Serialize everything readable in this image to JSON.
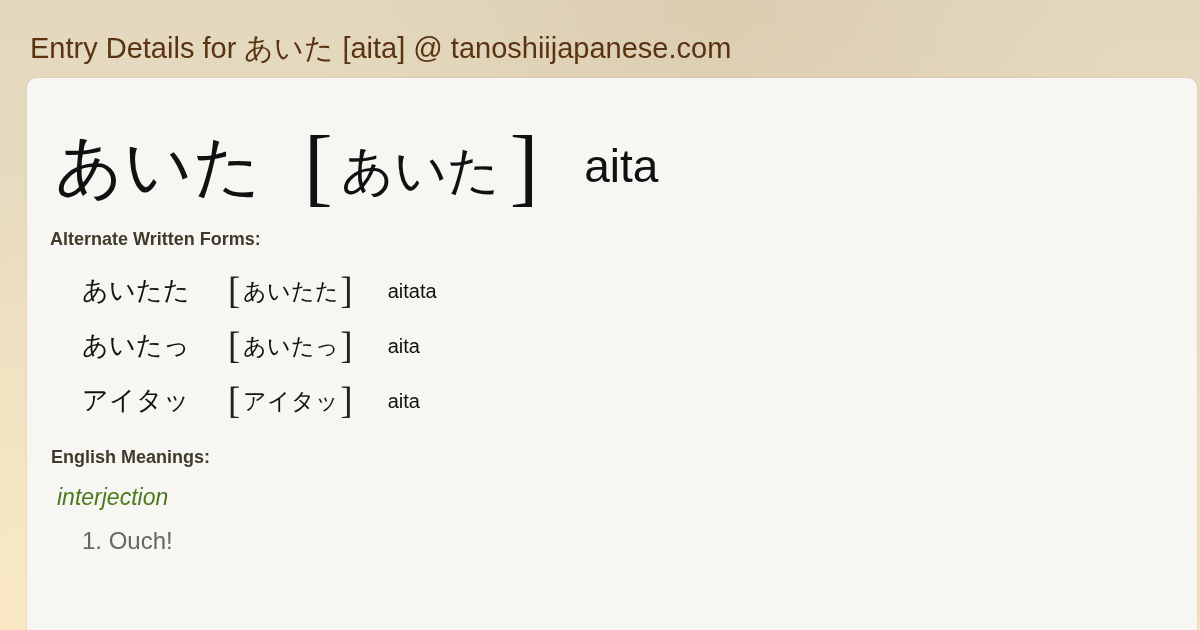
{
  "page_title": "Entry Details for あいた [aita] @ tanoshiijapanese.com",
  "entry": {
    "word": "あいた",
    "open_bracket": "[",
    "reading": "あいた",
    "close_bracket": "]",
    "romaji": "aita"
  },
  "alternate_forms": {
    "heading": "Alternate Written Forms:",
    "items": [
      {
        "word": "あいたた",
        "open_bracket": "[",
        "reading": "あいたた",
        "close_bracket": "]",
        "romaji": "aitata"
      },
      {
        "word": "あいたっ",
        "open_bracket": "[",
        "reading": "あいたっ",
        "close_bracket": "]",
        "romaji": "aita"
      },
      {
        "word": "アイタッ",
        "open_bracket": "[",
        "reading": "アイタッ",
        "close_bracket": "]",
        "romaji": "aita"
      }
    ]
  },
  "meanings": {
    "heading": "English Meanings:",
    "groups": [
      {
        "part_of_speech": "interjection",
        "senses": [
          "1. Ouch!"
        ]
      }
    ]
  }
}
